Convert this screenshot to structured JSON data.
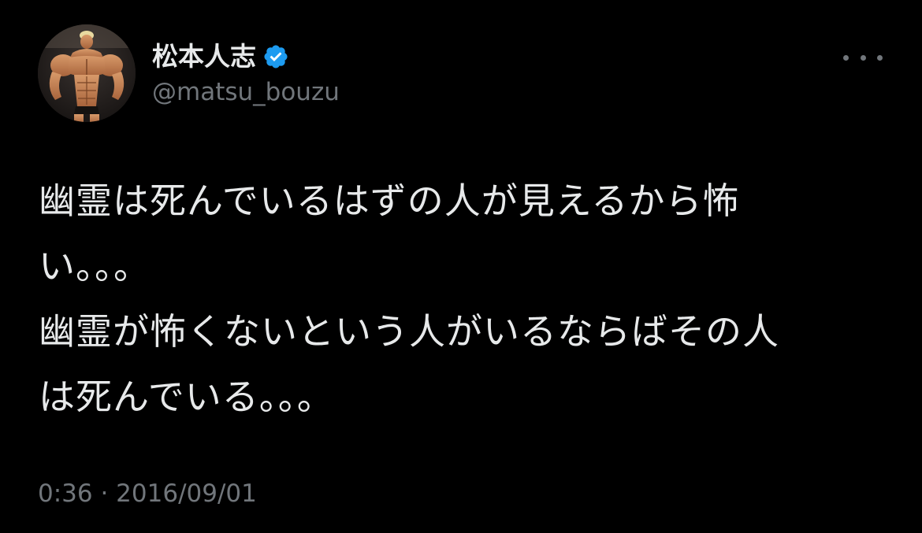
{
  "author": {
    "display_name": "松本人志",
    "handle": "@matsu_bouzu",
    "verified": true,
    "avatar": "muscular-figure-avatar"
  },
  "tweet": {
    "lines": [
      "幽霊は死んでいるはずの人が見えるから怖",
      "い。。。",
      "幽霊が怖くないという人がいるならばその人",
      "は死んでいる。。。"
    ],
    "timestamp": "0:36 · 2016/09/01"
  },
  "icons": {
    "more": "more-horizontal-icon",
    "verified": "verified-badge-icon"
  },
  "colors": {
    "background": "#000000",
    "text_primary": "#e7e9ea",
    "text_secondary": "#71767b",
    "verified_blue": "#1d9bf0"
  }
}
